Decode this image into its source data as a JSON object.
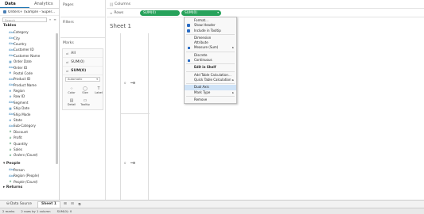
{
  "data_pane": {
    "tabs": [
      "Data",
      "Analytics"
    ],
    "datasource": "Orders+ (Sample - Super...",
    "search_placeholder": "Search",
    "tables_header": "Tables",
    "orders_fields": [
      {
        "icon": "Abc",
        "label": "Category",
        "kind": "dim"
      },
      {
        "icon": "Abc",
        "label": "City",
        "kind": "dim"
      },
      {
        "icon": "Abc",
        "label": "Country",
        "kind": "dim"
      },
      {
        "icon": "Abc",
        "label": "Customer ID",
        "kind": "dim"
      },
      {
        "icon": "Abc",
        "label": "Customer Name",
        "kind": "dim"
      },
      {
        "icon": "▦",
        "label": "Order Date",
        "kind": "dim"
      },
      {
        "icon": "Abc",
        "label": "Order ID",
        "kind": "dim"
      },
      {
        "icon": "⊕",
        "label": "Postal Code",
        "kind": "dim"
      },
      {
        "icon": "Abc",
        "label": "Product ID",
        "kind": "dim"
      },
      {
        "icon": "Abc",
        "label": "Product Name",
        "kind": "dim"
      },
      {
        "icon": "⊕",
        "label": "Region",
        "kind": "dim"
      },
      {
        "icon": "#",
        "label": "Row ID",
        "kind": "dim"
      },
      {
        "icon": "Abc",
        "label": "Segment",
        "kind": "dim"
      },
      {
        "icon": "▦",
        "label": "Ship Date",
        "kind": "dim"
      },
      {
        "icon": "Abc",
        "label": "Ship Mode",
        "kind": "dim"
      },
      {
        "icon": "⊕",
        "label": "State",
        "kind": "dim"
      },
      {
        "icon": "Abc",
        "label": "Sub-Category",
        "kind": "dim"
      },
      {
        "icon": "#",
        "label": "Discount",
        "kind": "mea"
      },
      {
        "icon": "#",
        "label": "Profit",
        "kind": "mea"
      },
      {
        "icon": "#",
        "label": "Quantity",
        "kind": "mea"
      },
      {
        "icon": "#",
        "label": "Sales",
        "kind": "mea"
      },
      {
        "icon": "#",
        "label": "Orders (Count)",
        "kind": "mea",
        "italic": true
      }
    ],
    "people_header": "People",
    "people_fields": [
      {
        "icon": "Abc",
        "label": "Person",
        "kind": "dim"
      },
      {
        "icon": "Abc",
        "label": "Region (People)",
        "kind": "dim"
      },
      {
        "icon": "#",
        "label": "People (Count)",
        "kind": "mea",
        "italic": true
      }
    ],
    "returns_header": "Returns"
  },
  "side": {
    "pages_title": "Pages",
    "filters_title": "Filters",
    "marks_title": "Marks",
    "marks_rows": [
      {
        "icon": "ııl",
        "label": "All",
        "bold": false
      },
      {
        "icon": "ııl",
        "label": "SUM(0)",
        "bold": false
      },
      {
        "icon": "ııl",
        "label": "SUM(0)",
        "bold": true
      }
    ],
    "mark_type": "Automatic",
    "mark_buttons": [
      {
        "icon": "⁘",
        "label": "Color",
        "name": "color"
      },
      {
        "icon": "◯",
        "label": "Size",
        "name": "size"
      },
      {
        "icon": "T",
        "label": "Label",
        "name": "label"
      },
      {
        "icon": "▤",
        "label": "Detail",
        "name": "detail"
      },
      {
        "icon": "▭",
        "label": "Tooltip",
        "name": "tooltip"
      }
    ]
  },
  "shelves": {
    "columns_label": "Columns",
    "rows_label": "Rows",
    "row_pills": [
      "SUM(0)",
      "SUM(0)"
    ]
  },
  "sheet": {
    "title": "Sheet 1",
    "axis_upper_label": "0",
    "axis_lower_label": "0"
  },
  "menu": {
    "items": [
      {
        "label": "Format...",
        "type": "normal"
      },
      {
        "label": "Show Header",
        "type": "checked"
      },
      {
        "label": "Include in Tooltip",
        "type": "checked"
      },
      {
        "sep": true
      },
      {
        "label": "Dimension",
        "type": "normal"
      },
      {
        "label": "Attribute",
        "type": "normal"
      },
      {
        "label": "Measure (Sum)",
        "type": "radio",
        "submenu": true
      },
      {
        "sep": true
      },
      {
        "label": "Discrete",
        "type": "normal"
      },
      {
        "label": "Continuous",
        "type": "radio"
      },
      {
        "sep": true
      },
      {
        "label": "Edit in Shelf",
        "type": "bold"
      },
      {
        "sep": true
      },
      {
        "label": "Add Table Calculation...",
        "type": "normal"
      },
      {
        "label": "Quick Table Calculation",
        "type": "normal",
        "submenu": true
      },
      {
        "sep": true
      },
      {
        "label": "Dual Axis",
        "type": "highlight"
      },
      {
        "label": "Mark Type",
        "type": "normal",
        "submenu": true
      },
      {
        "sep": true
      },
      {
        "label": "Remove",
        "type": "normal"
      }
    ]
  },
  "bottom_tabs": {
    "datasource_tab": "Data Source",
    "sheet_tab": "Sheet 1"
  },
  "status": {
    "marks": "2 marks",
    "rows_cols": "2 rows by 1 column",
    "sum": "SUM(0): 0"
  }
}
